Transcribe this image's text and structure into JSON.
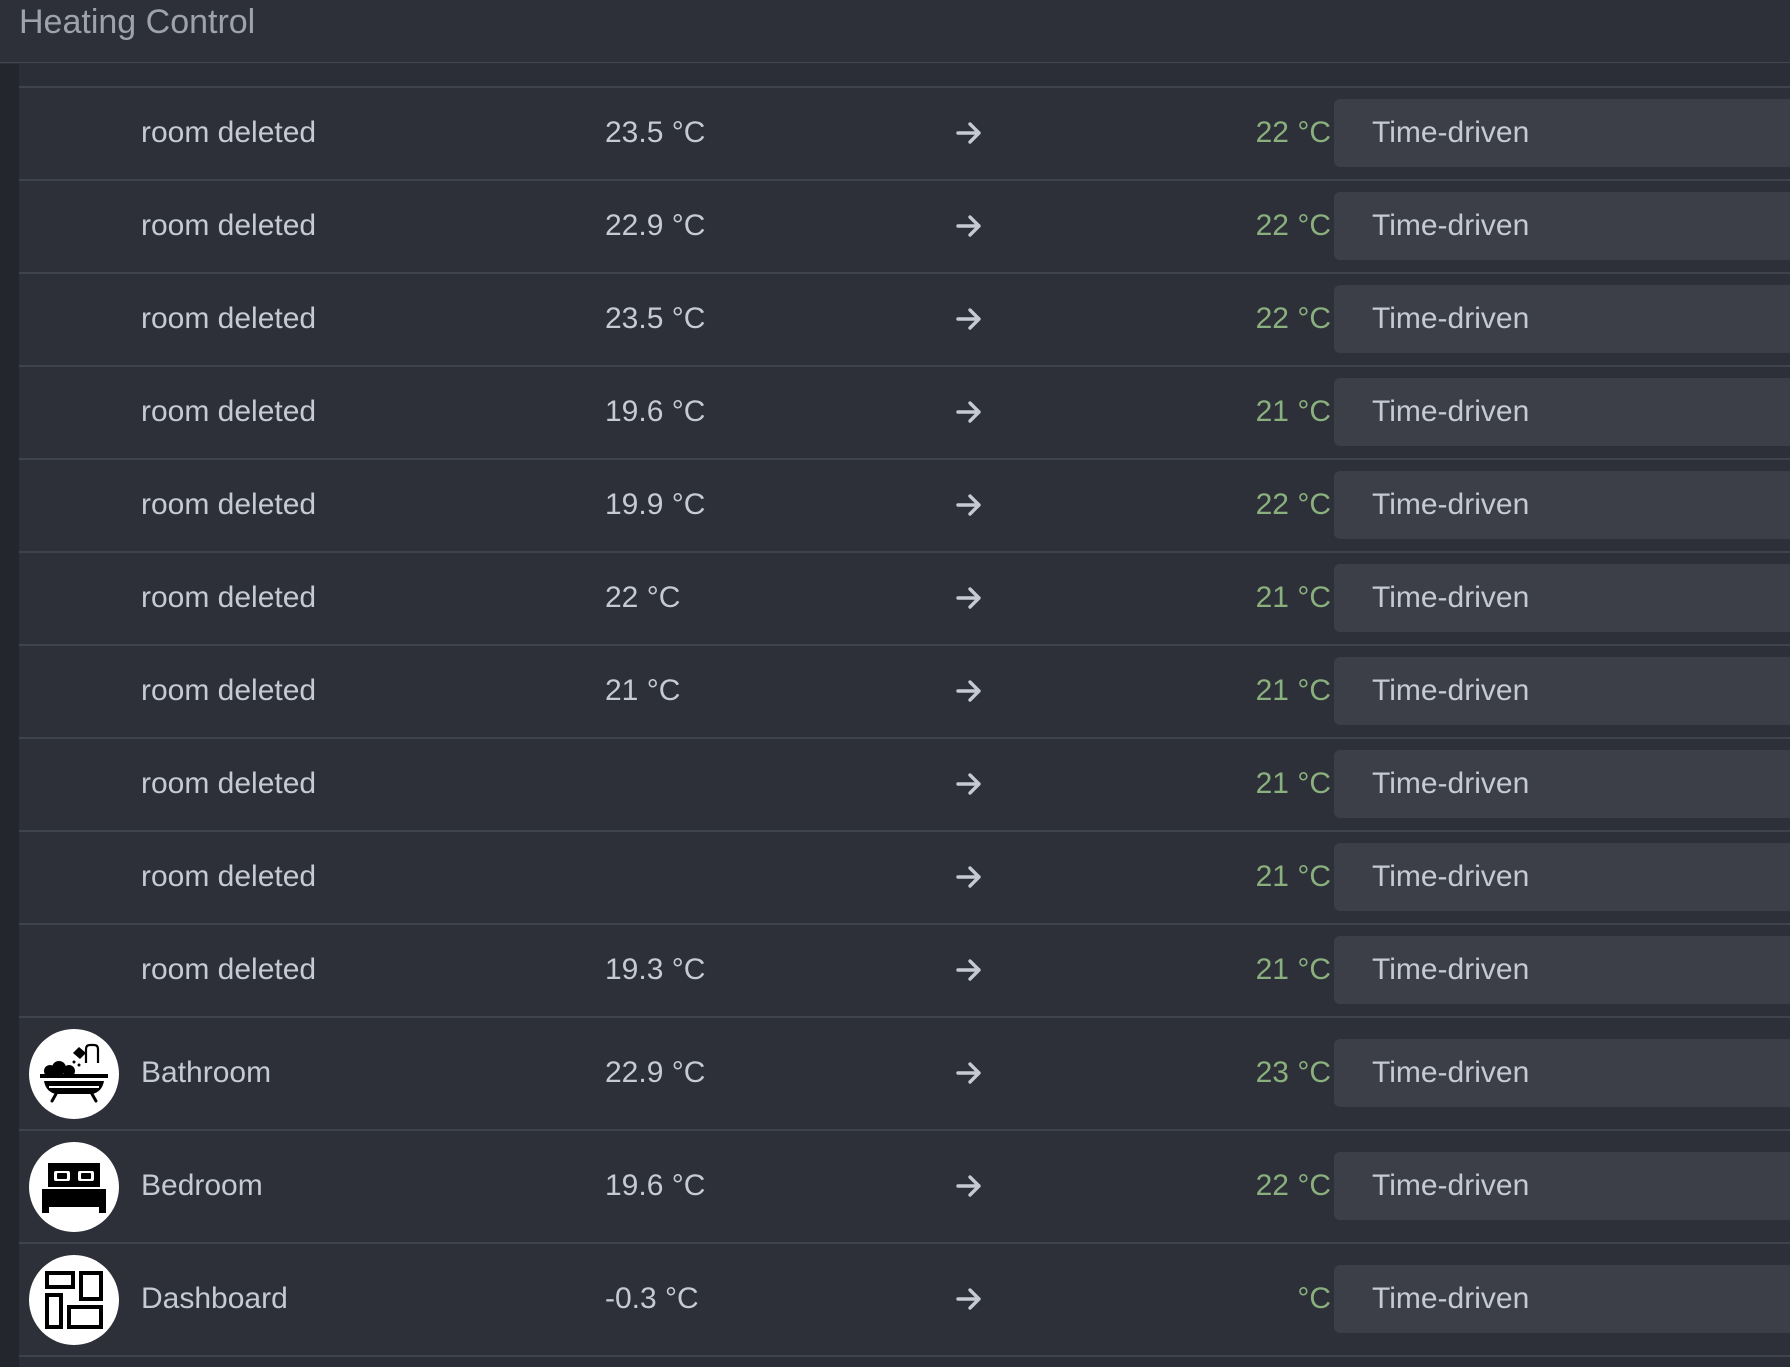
{
  "header": {
    "title": "Heating Control"
  },
  "rows": [
    {
      "name": "room deleted",
      "current": "23.5 °C",
      "target": "22 °C",
      "mode": "Time-driven"
    },
    {
      "name": "room deleted",
      "current": "22.9 °C",
      "target": "22 °C",
      "mode": "Time-driven"
    },
    {
      "name": "room deleted",
      "current": "23.5 °C",
      "target": "22 °C",
      "mode": "Time-driven"
    },
    {
      "name": "room deleted",
      "current": "19.6 °C",
      "target": "21 °C",
      "mode": "Time-driven"
    },
    {
      "name": "room deleted",
      "current": "19.9 °C",
      "target": "22 °C",
      "mode": "Time-driven"
    },
    {
      "name": "room deleted",
      "current": "22 °C",
      "target": "21 °C",
      "mode": "Time-driven"
    },
    {
      "name": "room deleted",
      "current": "21 °C",
      "target": "21 °C",
      "mode": "Time-driven"
    },
    {
      "name": "room deleted",
      "current": "",
      "target": "21 °C",
      "mode": "Time-driven"
    },
    {
      "name": "room deleted",
      "current": "",
      "target": "21 °C",
      "mode": "Time-driven"
    },
    {
      "name": "room deleted",
      "current": "19.3 °C",
      "target": "21 °C",
      "mode": "Time-driven"
    },
    {
      "name": "Bathroom",
      "icon": "bathtub-icon",
      "current": "22.9 °C",
      "target": "23 °C",
      "mode": "Time-driven"
    },
    {
      "name": "Bedroom",
      "icon": "bed-icon",
      "current": "19.6 °C",
      "target": "22 °C",
      "mode": "Time-driven"
    },
    {
      "name": "Dashboard",
      "icon": "dashboard-icon",
      "current": "-0.3 °C",
      "target": "°C",
      "mode": "Time-driven"
    }
  ]
}
